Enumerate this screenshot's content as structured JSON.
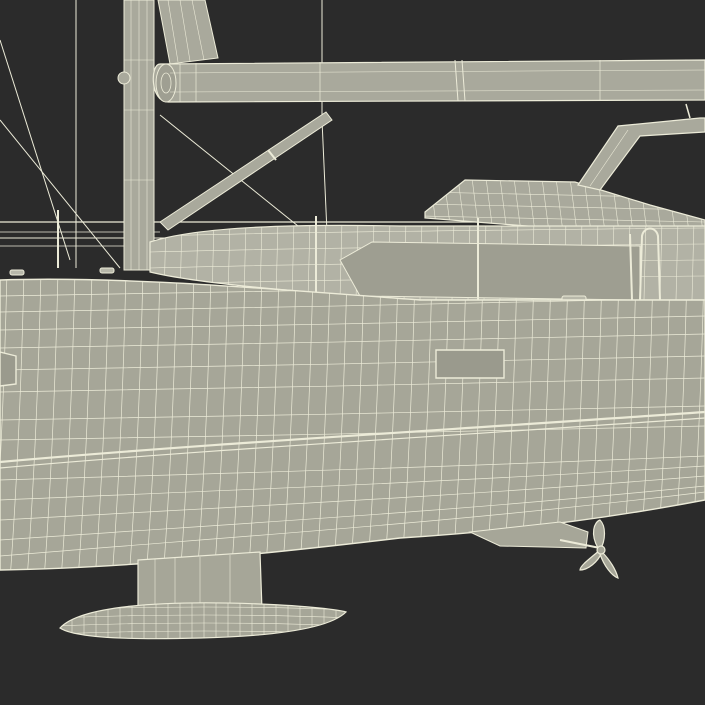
{
  "scene": {
    "background": "#2b2b2b",
    "hull_fill": "#a6a698",
    "hull_shade": "#8f8f83",
    "deck_fill": "#b2b2a5",
    "wire_color": "#ecebd8",
    "dark_wire": "#6e6e64"
  }
}
